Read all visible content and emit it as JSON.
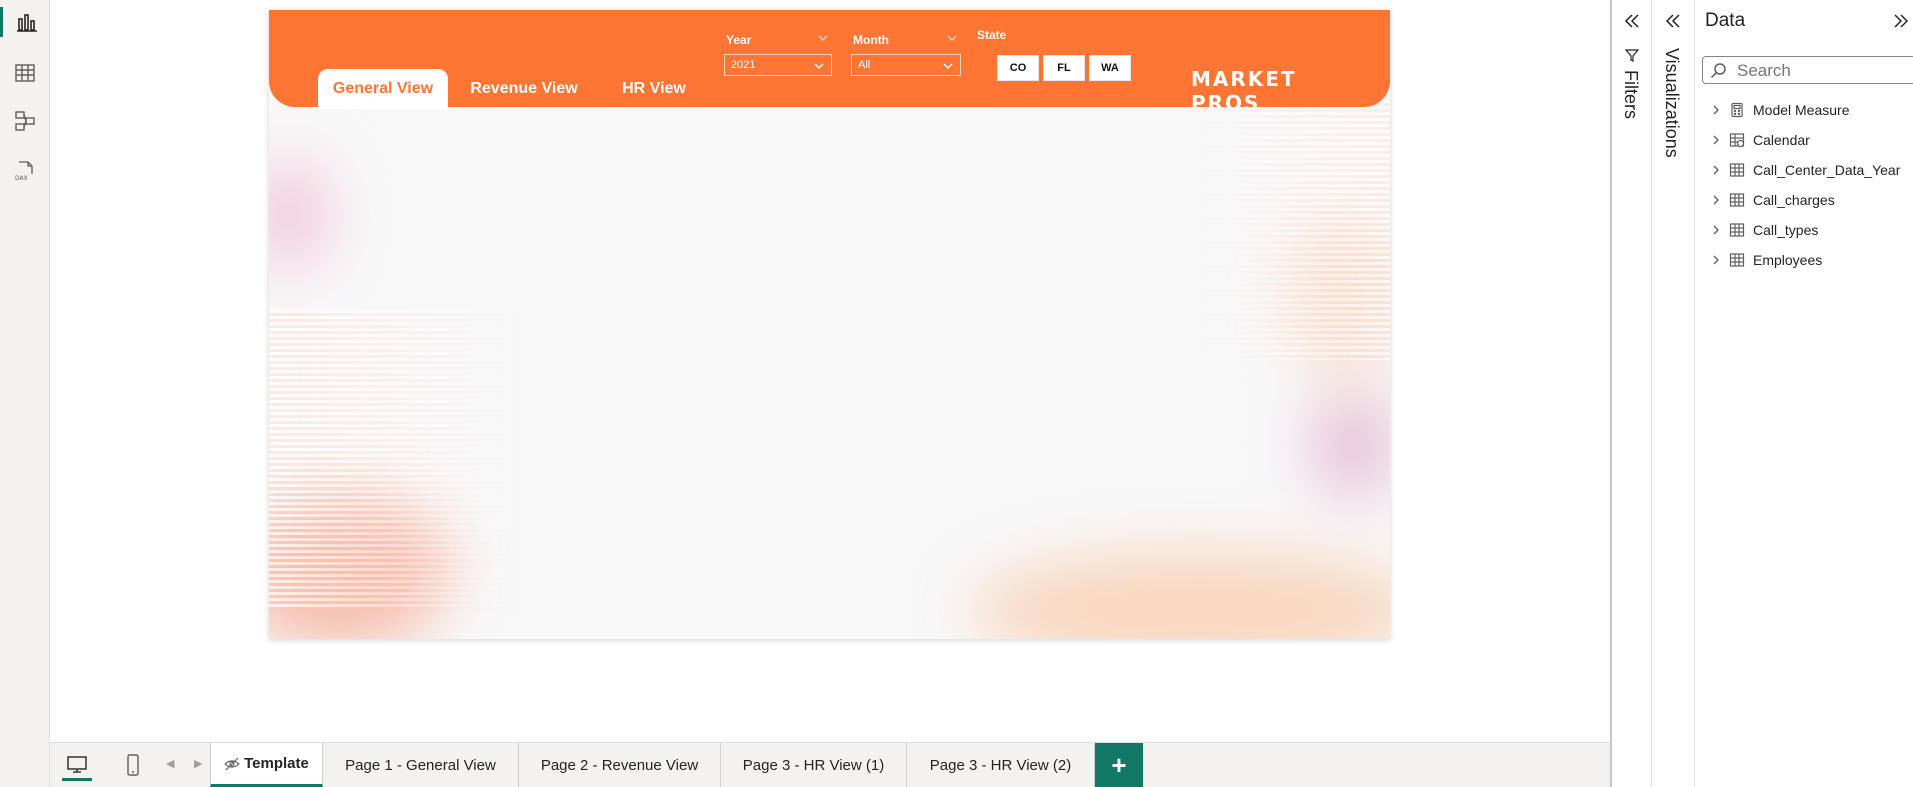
{
  "header": {
    "tabs": [
      {
        "label": "General View",
        "active": true
      },
      {
        "label": "Revenue View",
        "active": false
      },
      {
        "label": "HR View",
        "active": false
      }
    ],
    "year": {
      "label": "Year",
      "value": "2021"
    },
    "month": {
      "label": "Month",
      "value": "All"
    },
    "state": {
      "label": "State",
      "options": [
        "CO",
        "FL",
        "WA"
      ]
    },
    "brand": "MARKET PROS"
  },
  "panes": {
    "filters": "Filters",
    "visualizations": "Visualizations",
    "data": {
      "title": "Data",
      "search_placeholder": "Search",
      "fields": [
        {
          "label": "Model Measure",
          "icon": "calculator-icon"
        },
        {
          "label": "Calendar",
          "icon": "calendar-table-icon"
        },
        {
          "label": "Call_Center_Data_Year",
          "icon": "table-icon"
        },
        {
          "label": "Call_charges",
          "icon": "table-icon"
        },
        {
          "label": "Call_types",
          "icon": "table-icon"
        },
        {
          "label": "Employees",
          "icon": "table-icon"
        }
      ]
    }
  },
  "page_tabs": [
    {
      "label": "Template",
      "active": true,
      "hidden": true
    },
    {
      "label": "Page 1 - General View"
    },
    {
      "label": "Page 2 - Revenue View"
    },
    {
      "label": "Page 3 - HR View (1)"
    },
    {
      "label": "Page 3 - HR View (2)"
    }
  ],
  "add_page": "+",
  "colors": {
    "accent": "#fe7534",
    "brand_green": "#117865"
  }
}
